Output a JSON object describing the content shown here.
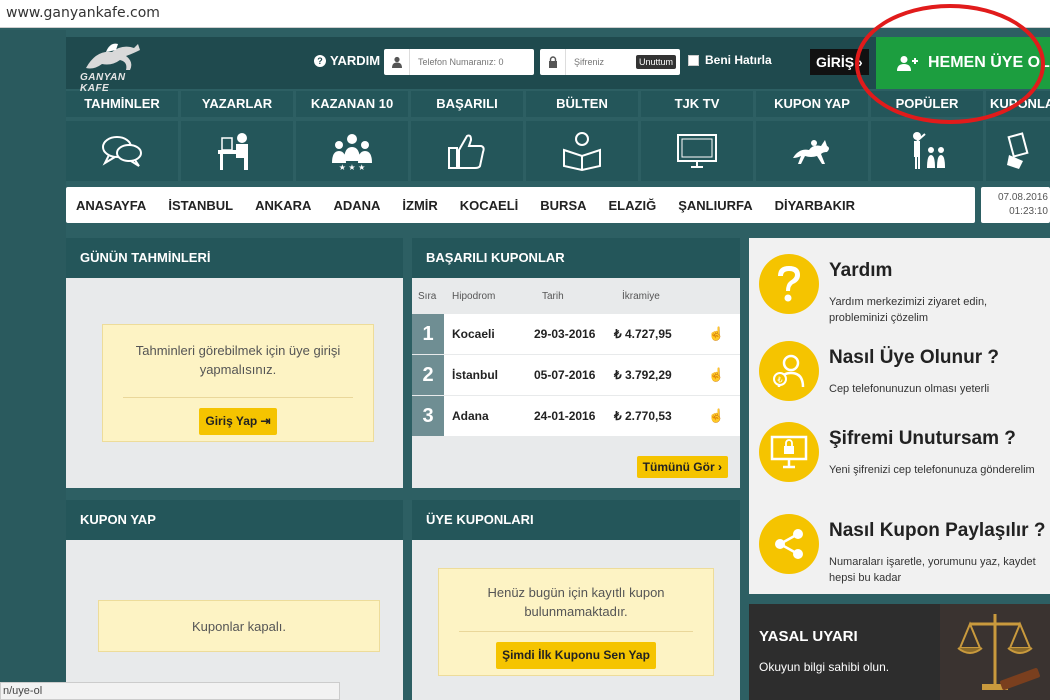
{
  "browser": {
    "url": "www.ganyankafe.com",
    "status_url": "n/uye-ol"
  },
  "header": {
    "logo_text": "GANYAN KAFE",
    "help_label": "YARDIM",
    "phone_placeholder": "Telefon Numaranız: 0",
    "password_placeholder": "Şifreniz",
    "forgot_label": "Unuttum",
    "remember_label": "Beni Hatırla",
    "login_label": "GİRİŞ",
    "signup_label": "HEMEN ÜYE OL"
  },
  "nav": [
    {
      "label": "TAHMİNLER",
      "icon": "chat-bubbles-icon"
    },
    {
      "label": "YAZARLAR",
      "icon": "writer-desk-icon"
    },
    {
      "label": "KAZANAN 10",
      "icon": "winners-group-icon"
    },
    {
      "label": "BAŞARILI",
      "icon": "thumbs-up-icon"
    },
    {
      "label": "BÜLTEN",
      "icon": "reader-book-icon"
    },
    {
      "label": "TJK TV",
      "icon": "monitor-icon"
    },
    {
      "label": "KUPON YAP",
      "icon": "horse-racing-icon"
    },
    {
      "label": "POPÜLER",
      "icon": "popular-people-icon"
    },
    {
      "label": "KUPONLARINIZ",
      "icon": "coupon-hand-icon"
    }
  ],
  "cities": [
    "ANASAYFA",
    "İSTANBUL",
    "ANKARA",
    "ADANA",
    "İZMİR",
    "KOCAELİ",
    "BURSA",
    "ELAZIĞ",
    "ŞANLIURFA",
    "DİYARBAKIR"
  ],
  "datetime": {
    "date": "07.08.2016",
    "time": "01:23:10"
  },
  "predictions": {
    "title": "GÜNÜN TAHMİNLERİ",
    "message": "Tahminleri görebilmek için üye girişi yapmalısınız.",
    "button": "Giriş Yap"
  },
  "coupons": {
    "title": "BAŞARILI KUPONLAR",
    "columns": [
      "Sıra",
      "Hipodrom",
      "Tarih",
      "İkramiye"
    ],
    "rows": [
      {
        "rank": "1",
        "track": "Kocaeli",
        "date": "29-03-2016",
        "prize": "₺ 4.727,95"
      },
      {
        "rank": "2",
        "track": "İstanbul",
        "date": "05-07-2016",
        "prize": "₺ 3.792,29"
      },
      {
        "rank": "3",
        "track": "Adana",
        "date": "24-01-2016",
        "prize": "₺ 2.770,53"
      }
    ],
    "see_all": "Tümünü Gör"
  },
  "coupon_make": {
    "title": "KUPON YAP",
    "message": "Kuponlar kapalı."
  },
  "member_coupons": {
    "title": "ÜYE KUPONLARI",
    "message": "Henüz bugün için kayıtlı kupon bulunmamaktadır.",
    "button": "Şimdi İlk Kuponu Sen Yap"
  },
  "side": [
    {
      "title": "Yardım",
      "desc": "Yardım merkezimizi ziyaret edin, probleminizi çözelim",
      "icon": "question-icon"
    },
    {
      "title": "Nasıl Üye Olunur ?",
      "desc": "Cep telefonunuzun olması yeterli",
      "icon": "user-coin-icon"
    },
    {
      "title": "Şifremi Unutursam ?",
      "desc": "Yeni şifrenizi cep telefonunuza gönderelim",
      "icon": "lock-monitor-icon"
    },
    {
      "title": "Nasıl Kupon Paylaşılır ?",
      "desc": "Numaraları işaretle, yorumunu yaz, kaydet hepsi bu kadar",
      "icon": "share-icon"
    }
  ],
  "legal": {
    "title": "YASAL UYARI",
    "desc": "Okuyun bilgi sahibi olun."
  },
  "colors": {
    "accent": "#f5c400",
    "dark": "#24565a",
    "green": "#1c9e3f",
    "highlight": "#e11b1b"
  }
}
